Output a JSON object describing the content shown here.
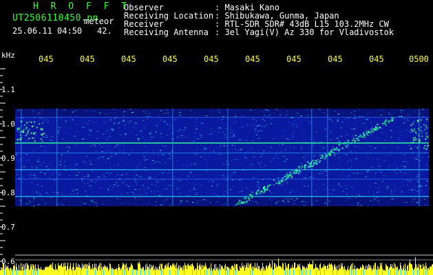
{
  "header": {
    "app_name": "H R O F F T",
    "filename": "UT2506110450.pn",
    "meteor_label": "meteor",
    "datetime": "25.06.11 04:50",
    "count": "42.",
    "observer_label": "Observer",
    "observer_value": ": Masaki Kano",
    "location_label": "Receiving Location",
    "location_value": ": Shibukawa, Gunma, Japan",
    "receiver_label": "Receiver",
    "receiver_value": ": RTL-SDR SDR# 43dB L15 103.2MHz CW",
    "antenna_label": "Receiving Antenna",
    "antenna_value": ": 3el Yagi(V) Az 330 for Vladivostok"
  },
  "time_axis": [
    "045",
    "045",
    "045",
    "045",
    "045",
    "045",
    "045",
    "045",
    "045",
    "0500"
  ],
  "freq_axis": {
    "unit": "kHz",
    "ticks": [
      "1.1",
      "1.0",
      "0.9",
      "0.8",
      "0.7",
      "0.6"
    ]
  },
  "colors": {
    "background": "#000000",
    "green_text": "#33ff33",
    "time_labels": "#ffff33",
    "waterfall_base": "#0a1aa0",
    "echo_color": "#39ffd0"
  }
}
